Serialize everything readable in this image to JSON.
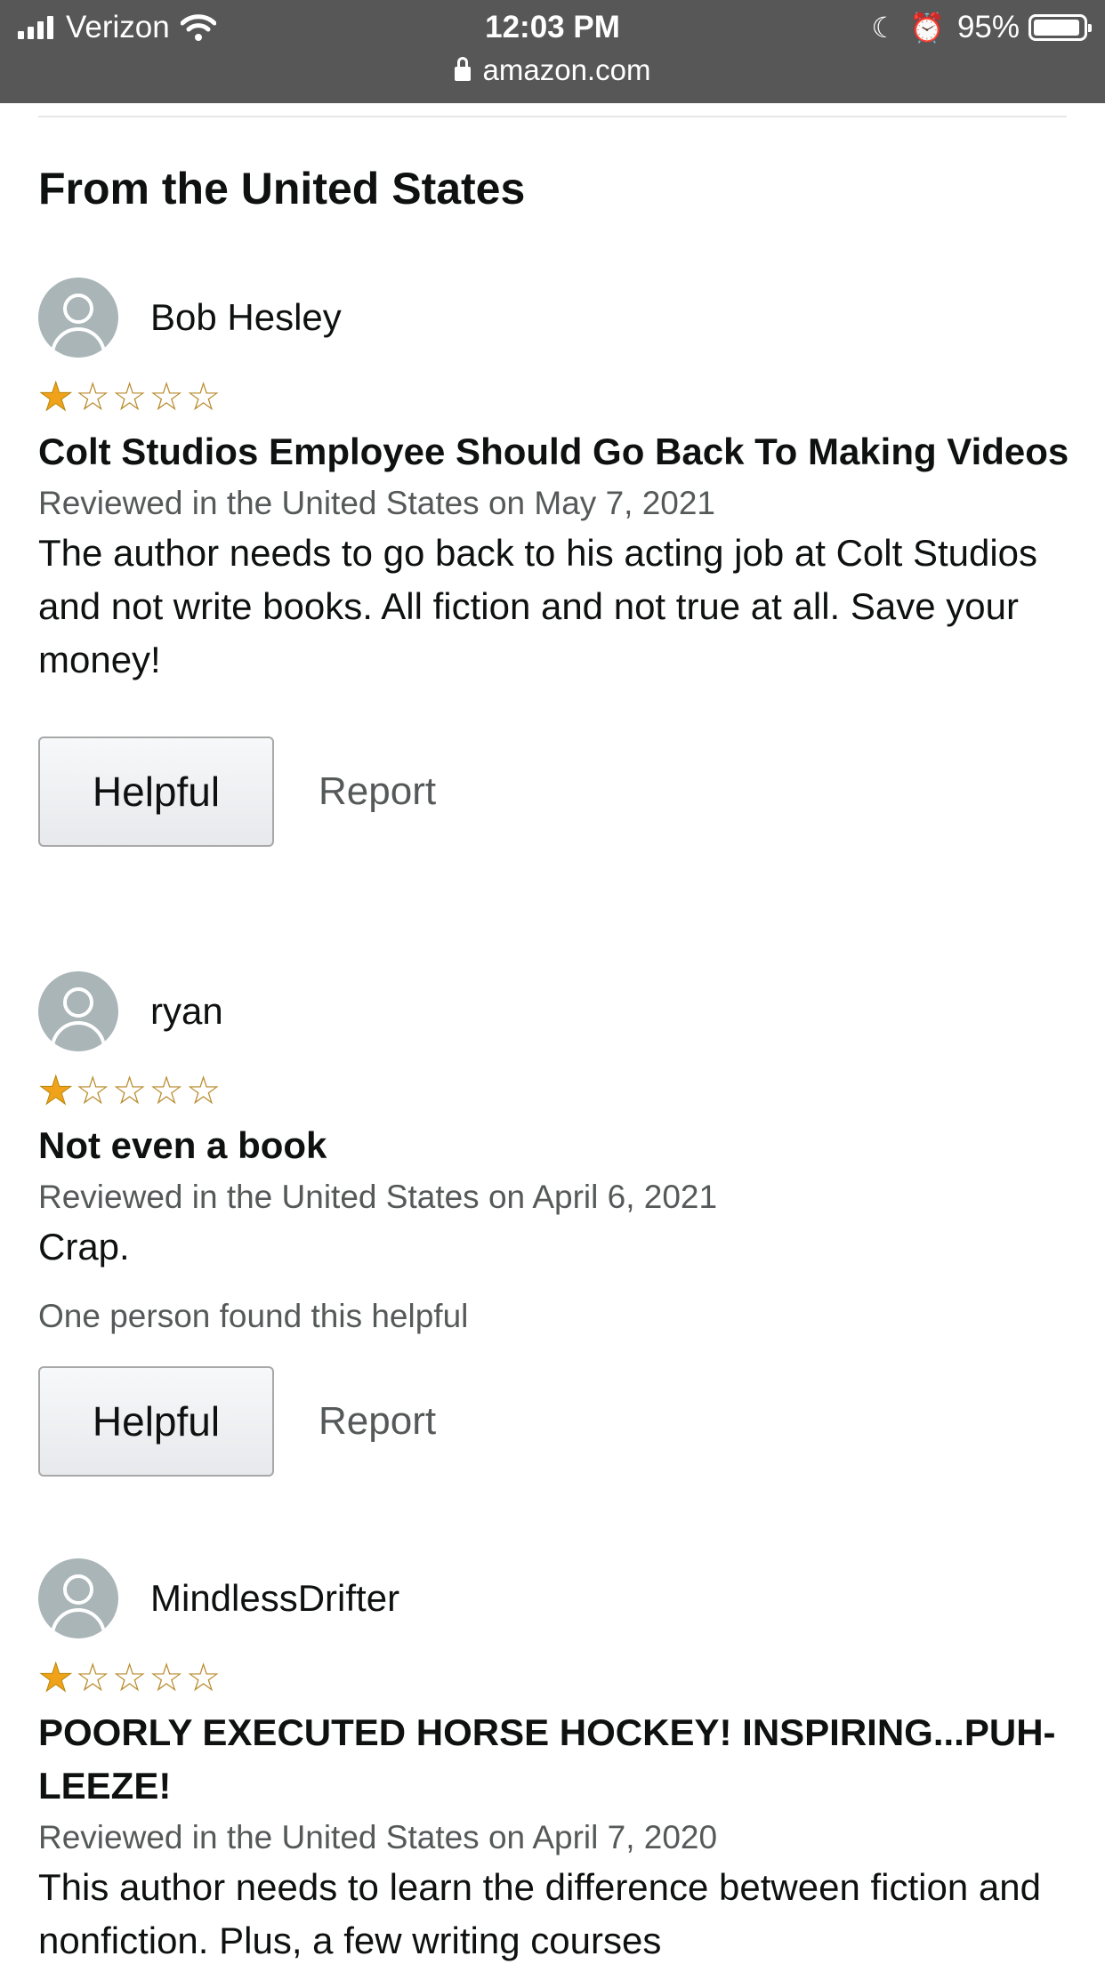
{
  "status_bar": {
    "carrier": "Verizon",
    "time": "12:03 PM",
    "url": "amazon.com",
    "battery": "95%",
    "battery_level": 0.95,
    "icons": [
      "signal-icon",
      "wifi-icon",
      "moon-icon",
      "alarm-icon",
      "battery-icon",
      "lock-icon"
    ]
  },
  "section": {
    "title": "From the United States"
  },
  "reviews": [
    {
      "reviewer": "Bob Hesley",
      "rating": 1,
      "max_rating": 5,
      "title": "Colt Studios Employee Should Go Back To Making Videos",
      "date": "Reviewed in the United States on May 7, 2021",
      "body": "The author needs to go back to his acting job at Colt Studios and not write books. All fiction and not true at all. Save your money!",
      "helpful_count": "",
      "helpful_label": "Helpful",
      "report_label": "Report"
    },
    {
      "reviewer": "ryan",
      "rating": 1,
      "max_rating": 5,
      "title": "Not even a book",
      "date": "Reviewed in the United States on April 6, 2021",
      "body": "Crap.",
      "helpful_count": "One person found this helpful",
      "helpful_label": "Helpful",
      "report_label": "Report"
    },
    {
      "reviewer": "MindlessDrifter",
      "rating": 1,
      "max_rating": 5,
      "title": "POORLY EXECUTED HORSE HOCKEY! INSPIRING...PUH-LEEZE!",
      "date": "Reviewed in the United States on April 7, 2020",
      "body": "This author needs to learn the difference between fiction and nonfiction. Plus, a few writing courses",
      "helpful_count": "",
      "helpful_label": "",
      "report_label": ""
    }
  ],
  "colors": {
    "status_bar": "#575757",
    "star": "#f0a31a",
    "muted_text": "#565959",
    "text": "#0f1111"
  }
}
